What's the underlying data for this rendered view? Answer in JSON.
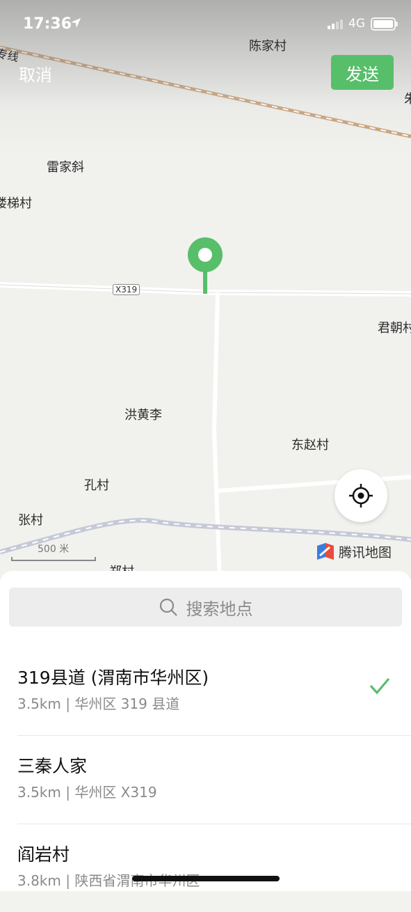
{
  "status_bar": {
    "time": "17:36",
    "network": "4G"
  },
  "header": {
    "cancel_label": "取消",
    "send_label": "发送"
  },
  "map": {
    "places": {
      "chenjia": "陈家村",
      "zhuanxian": "专线",
      "leijiaxie": "雷家斜",
      "loutiao": "楼梯村",
      "junchao": "君朝村",
      "honghuangli": "洪黄李",
      "dongzhao": "东赵村",
      "kongcun": "孔村",
      "zhangcun": "张村",
      "zhengcun": "郑村",
      "edge_zhu": "朱"
    },
    "road_label": "X319",
    "scale_label": "500 米",
    "brand": "腾讯地图",
    "accent_color": "#57be6a"
  },
  "search": {
    "placeholder": "搜索地点"
  },
  "results": [
    {
      "title": "319县道 (渭南市华州区)",
      "subtitle": "3.5km | 华州区 319 县道",
      "selected": true
    },
    {
      "title": "三秦人家",
      "subtitle": "3.5km | 华州区 X319",
      "selected": false
    },
    {
      "title": "阎岩村",
      "subtitle": "3.8km | 陕西省渭南市华州区",
      "selected": false
    }
  ]
}
